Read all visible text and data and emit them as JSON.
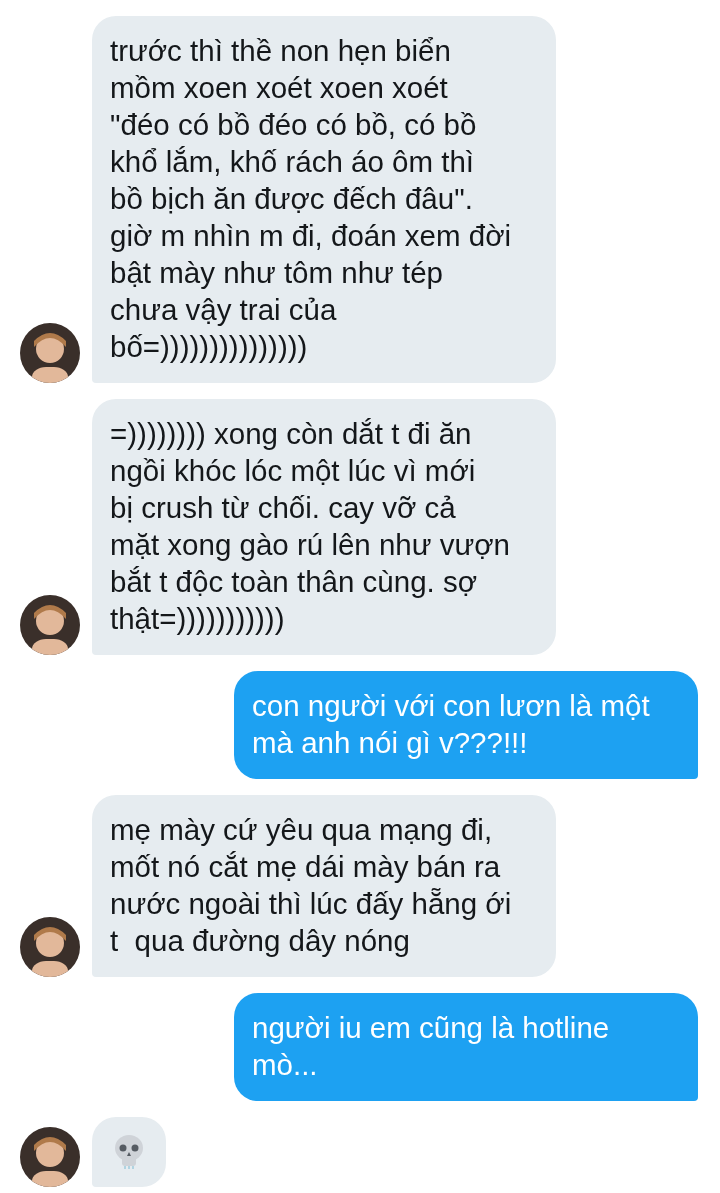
{
  "messages": [
    {
      "outgoing": false,
      "kind": "text",
      "text": "trước thì thề non hẹn biển\nmồm xoen xoét xoen xoét\n\"đéo có bồ đéo có bồ, có bồ\nkhổ lắm, khố rách áo ôm thì\nbồ bịch ăn được đếch đâu\".\ngiờ m nhìn m đi, đoán xem đời\nbật mày như tôm như tép\nchưa vậy trai của\nbố=)))))))))))))))"
    },
    {
      "outgoing": false,
      "kind": "text",
      "text": "=)))))))) xong còn dắt t đi ăn\nngồi khóc lóc một lúc vì mới\nbị crush từ chối. cay vỡ cả\nmặt xong gào rú lên như vượn\nbắt t độc toàn thân cùng. sợ\nthật=)))))))))))"
    },
    {
      "outgoing": true,
      "kind": "text",
      "text": "con người với con lươn là một\nmà anh nói gì v???!!!"
    },
    {
      "outgoing": false,
      "kind": "text",
      "text": "mẹ mày cứ yêu qua mạng đi,\nmốt nó cắt mẹ dái mày bán ra\nnước ngoài thì lúc đấy hẵng ới\nt  qua đường dây nóng"
    },
    {
      "outgoing": true,
      "kind": "text",
      "text": "người iu em cũng là hotline\nmò..."
    },
    {
      "outgoing": false,
      "kind": "emoji"
    }
  ]
}
